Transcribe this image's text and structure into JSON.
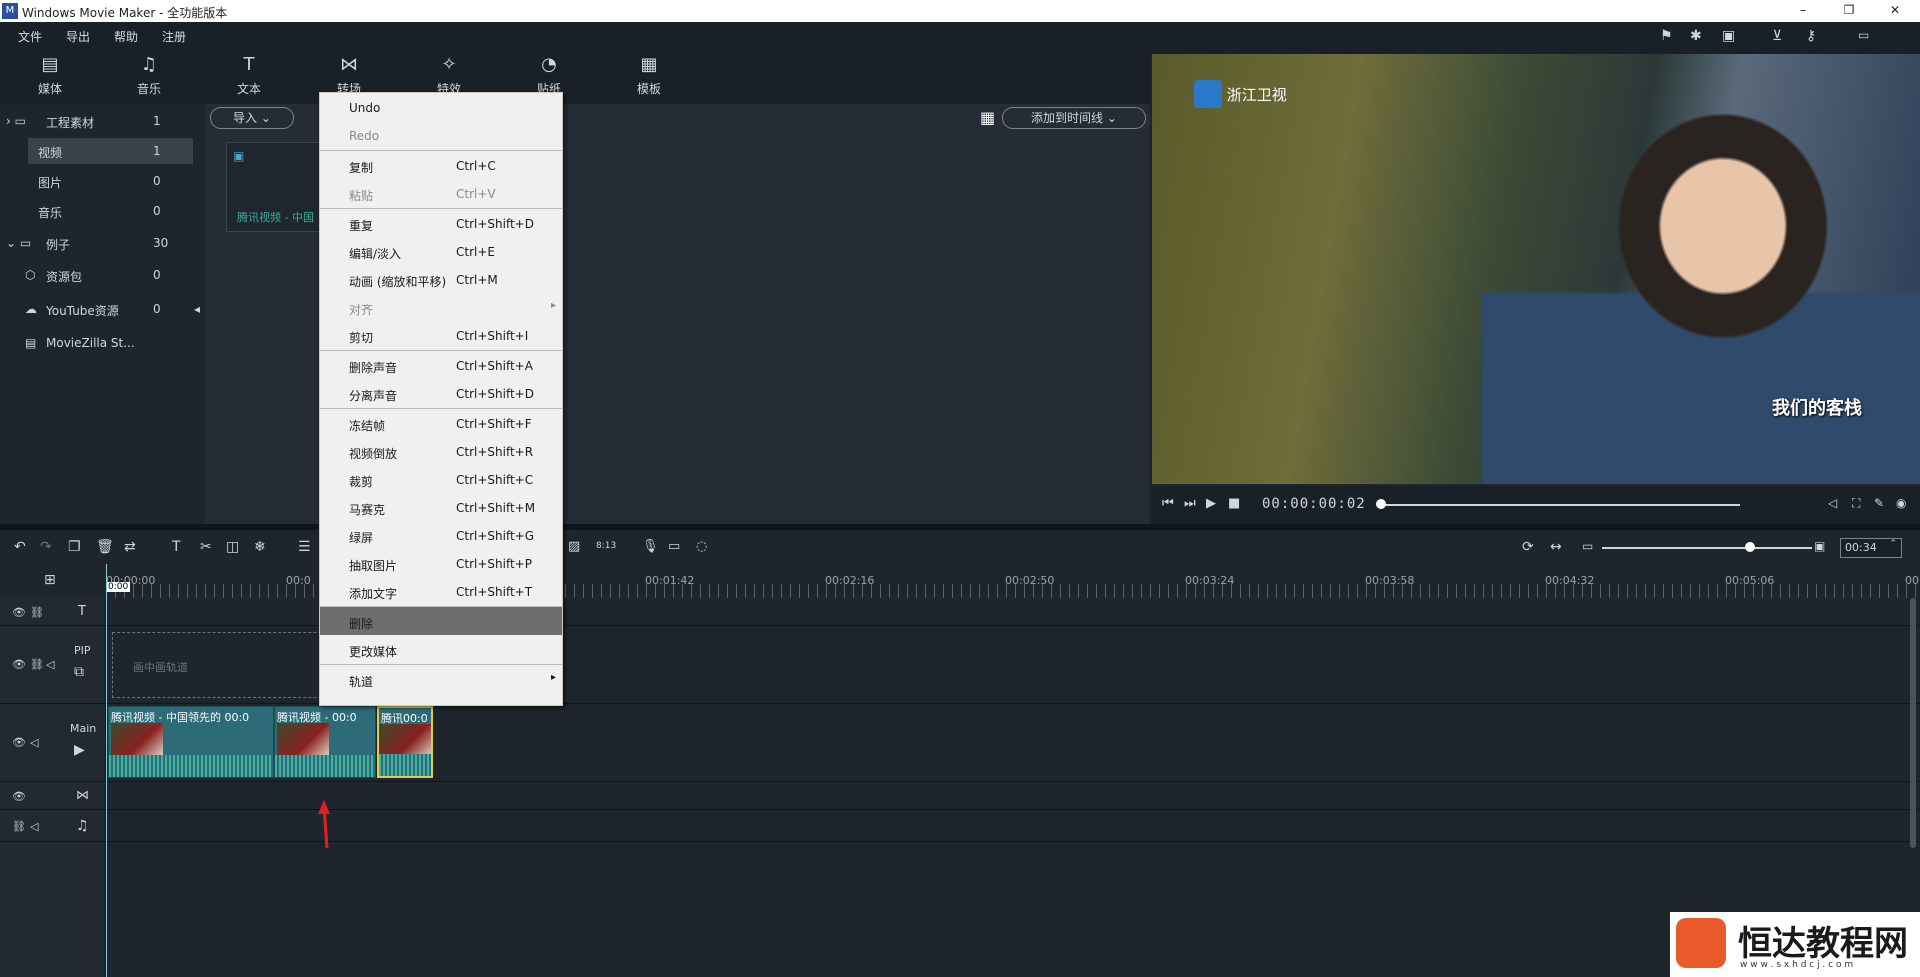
{
  "window": {
    "title": "Windows Movie Maker - 全功能版本"
  },
  "menubar": {
    "items": [
      "文件",
      "导出",
      "帮助",
      "注册"
    ]
  },
  "toolbar": {
    "items": [
      {
        "label": "媒体",
        "icon": "media-icon"
      },
      {
        "label": "音乐",
        "icon": "music-icon"
      },
      {
        "label": "文本",
        "icon": "text-icon"
      },
      {
        "label": "转场",
        "icon": "transition-icon"
      },
      {
        "label": "特效",
        "icon": "effects-icon"
      },
      {
        "label": "贴纸",
        "icon": "sticker-icon"
      },
      {
        "label": "模板",
        "icon": "template-icon"
      }
    ]
  },
  "left_panel": {
    "project": {
      "label": "工程素材",
      "count": "1"
    },
    "video": {
      "label": "视频",
      "count": "1"
    },
    "image": {
      "label": "图片",
      "count": "0"
    },
    "music": {
      "label": "音乐",
      "count": "0"
    },
    "example": {
      "label": "例子",
      "count": "30"
    },
    "pack": {
      "label": "资源包",
      "count": "0"
    },
    "youtube": {
      "label": "YouTube资源",
      "count": "0"
    },
    "studio": {
      "label": "MovieZilla St..."
    }
  },
  "media": {
    "import_label": "导入",
    "add_to_timeline": "添加到时间线",
    "clip_name": "腾讯视频 - 中国"
  },
  "preview": {
    "channel_logo": "浙江卫视",
    "show_logo": "我们的客栈",
    "timecode": "00:00:00:02"
  },
  "timeline": {
    "zoom": "00:34",
    "ruler": [
      "00:00:00",
      "00:0",
      "00:01:42",
      "00:02:16",
      "00:02:50",
      "00:03:24",
      "00:03:58",
      "00:04:32",
      "00:05:06",
      "00"
    ],
    "playhead_label": "0:00",
    "tracks": {
      "pip_label": "PIP",
      "pip_placeholder": "画中画轨道",
      "main_label": "Main"
    },
    "clips": [
      {
        "title": "腾讯视频 - 中国领先的 00:0"
      },
      {
        "title": "腾讯视频 - 00:0"
      },
      {
        "title": "腾讯00:0"
      }
    ]
  },
  "context_menu": {
    "items": [
      {
        "label": "Undo",
        "shortcut": "",
        "disabled": false
      },
      {
        "label": "Redo",
        "shortcut": "",
        "disabled": true
      },
      {
        "label": "复制",
        "shortcut": "Ctrl+C",
        "disabled": false
      },
      {
        "label": "粘贴",
        "shortcut": "Ctrl+V",
        "disabled": true
      },
      {
        "label": "重复",
        "shortcut": "Ctrl+Shift+D",
        "disabled": false
      },
      {
        "label": "编辑/淡入",
        "shortcut": "Ctrl+E",
        "disabled": false
      },
      {
        "label": "动画 (缩放和平移)",
        "shortcut": "Ctrl+M",
        "disabled": false
      },
      {
        "label": "对齐",
        "shortcut": "",
        "disabled": true
      },
      {
        "label": "剪切",
        "shortcut": "Ctrl+Shift+I",
        "disabled": false
      },
      {
        "label": "删除声音",
        "shortcut": "Ctrl+Shift+A",
        "disabled": false
      },
      {
        "label": "分离声音",
        "shortcut": "Ctrl+Shift+D",
        "disabled": false
      },
      {
        "label": "冻结帧",
        "shortcut": "Ctrl+Shift+F",
        "disabled": false
      },
      {
        "label": "视频倒放",
        "shortcut": "Ctrl+Shift+R",
        "disabled": false
      },
      {
        "label": "裁剪",
        "shortcut": "Ctrl+Shift+C",
        "disabled": false
      },
      {
        "label": "马赛克",
        "shortcut": "Ctrl+Shift+M",
        "disabled": false
      },
      {
        "label": "绿屏",
        "shortcut": "Ctrl+Shift+G",
        "disabled": false
      },
      {
        "label": "抽取图片",
        "shortcut": "Ctrl+Shift+P",
        "disabled": false
      },
      {
        "label": "添加文字",
        "shortcut": "Ctrl+Shift+T",
        "disabled": false
      },
      {
        "label": "删除",
        "shortcut": "",
        "disabled": false,
        "highlighted": true
      },
      {
        "label": "更改媒体",
        "shortcut": "",
        "disabled": false
      },
      {
        "label": "轨道",
        "shortcut": "",
        "disabled": false
      }
    ]
  },
  "watermark": {
    "text": "恒达教程网",
    "url": "w w w . s x h d c j . c o m"
  },
  "colors": {
    "accent": "#2c6b77",
    "highlight": "#6e6e6e",
    "arrow": "#e02020"
  }
}
